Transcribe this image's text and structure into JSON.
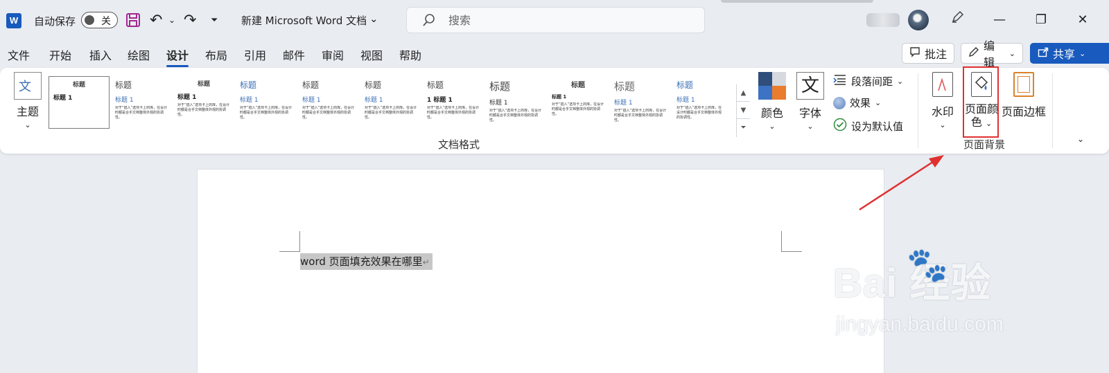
{
  "titlebar": {
    "app_logo": "W",
    "autosave_label": "自动保存",
    "autosave_state": "关",
    "doc_title": "新建 Microsoft Word 文档",
    "doc_title_caret": "⌄",
    "search_placeholder": "搜索",
    "undo_caret": "⌄",
    "customize": "⏷",
    "minimize": "—",
    "maximize": "❐",
    "close": "✕"
  },
  "tabs": [
    "文件",
    "开始",
    "插入",
    "绘图",
    "设计",
    "布局",
    "引用",
    "邮件",
    "审阅",
    "视图",
    "帮助"
  ],
  "active_tab": "设计",
  "right_buttons": {
    "comment": "批注",
    "edit": "编辑",
    "share": "共享"
  },
  "ribbon": {
    "theme": {
      "label": "主题",
      "icon_text": "文"
    },
    "gallery": [
      {
        "head": "标题",
        "sub": "标题 1",
        "style": "selected"
      },
      {
        "head": "标题",
        "sub": "标题 1",
        "style": "plain"
      },
      {
        "head": "标题",
        "sub": "标题 1",
        "style": "centered"
      },
      {
        "head": "标题",
        "sub": "标题 1",
        "style": "plain"
      },
      {
        "head": "标题",
        "sub": "标题 1",
        "style": "plain"
      },
      {
        "head": "标题",
        "sub": "标题 1",
        "style": "plain"
      },
      {
        "head": "标题",
        "sub": "1  标题 1",
        "style": "plain"
      },
      {
        "head": "标题",
        "sub": "标题 1",
        "style": "plain"
      },
      {
        "head": "标题",
        "sub": "标题 1",
        "style": "centered"
      },
      {
        "head": "标题",
        "sub": "标题 1",
        "style": "plain"
      },
      {
        "head": "标题",
        "sub": "标题 1",
        "style": "plain"
      }
    ],
    "gallery_body": "对于“插入”选项卡上的库，在设计时都是合乎文档整体外观的协调性。",
    "doc_format_group": "文档格式",
    "colors": "颜色",
    "fonts": "字体",
    "fonts_icon": "文",
    "paragraph_spacing": "段落间距",
    "effects": "效果",
    "set_default": "设为默认值",
    "watermark": "水印",
    "page_color": "页面颜色",
    "page_border": "页面边框",
    "page_background_group": "页面背景",
    "highlight_color": "#e03030"
  },
  "document": {
    "text": "word 页面填充效果在哪里",
    "paragraph_mark": "↵"
  },
  "watermark": {
    "logo": "Bai  经验",
    "url": "jingyan.baidu.com"
  },
  "colors": {
    "accent": "#185abd",
    "annotation": "#e03030"
  }
}
